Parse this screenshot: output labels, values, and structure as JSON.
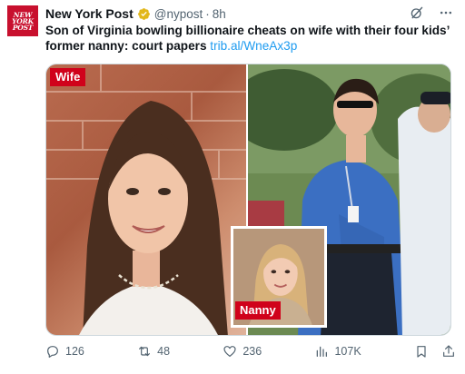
{
  "account": {
    "name": "New York Post",
    "handle": "@nypost",
    "separator": "·",
    "time": "8h",
    "avatar_lines": [
      "NEW",
      "YORK",
      "POST"
    ],
    "verified_icon": "gold-check-badge"
  },
  "tweet": {
    "text": "Son of Virginia bowling billionaire cheats on wife with their four kids’ former nanny: court papers ",
    "link": "trib.al/WneAx3p"
  },
  "media": {
    "label_left": "Wife",
    "label_inset": "Nanny"
  },
  "actions": {
    "replies": "126",
    "reposts": "48",
    "likes": "236",
    "views": "107K"
  },
  "colors": {
    "brand_red": "#c8102e",
    "label_red": "#d0021b",
    "link_blue": "#1d9bf0",
    "muted_gray": "#536471",
    "verified_gold": "#e2b719"
  }
}
